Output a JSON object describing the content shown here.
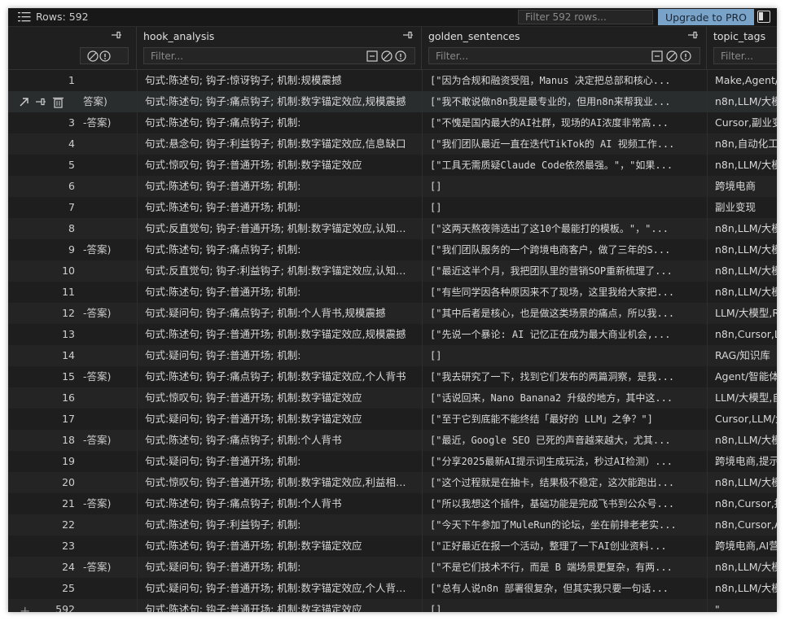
{
  "topbar": {
    "rows_label": "Rows: 592",
    "filter_placeholder": "Filter 592 rows...",
    "upgrade_label": "Upgrade to PRO"
  },
  "columns": [
    {
      "name": "hook_analysis",
      "filter_placeholder": "Filter..."
    },
    {
      "name": "golden_sentences",
      "filter_placeholder": "Filter..."
    },
    {
      "name": "topic_tags",
      "filter_placeholder": "Filter..."
    }
  ],
  "rows": [
    {
      "num": "1",
      "prev": "",
      "hook": "句式:陈述句; 钩子:惊讶钩子; 机制:规模震撼",
      "gold": "[\"因为合规和融资受阻，Manus 决定把总部和核心...",
      "topic": "Make,Agent/智"
    },
    {
      "num": "",
      "prev": "答案)",
      "hook": "句式:陈述句; 钩子:痛点钩子; 机制:数字锚定效应,规模震撼",
      "gold": "[\"我不敢说做n8n我是最专业的，但用n8n来帮我业...",
      "topic": "n8n,LLM/大模型"
    },
    {
      "num": "3",
      "prev": "-答案)",
      "hook": "句式:陈述句; 钩子:痛点钩子; 机制:",
      "gold": "[\"不愧是国内最大的AI社群，现场的AI浓度非常高...",
      "topic": "Cursor,副业变现"
    },
    {
      "num": "4",
      "prev": "",
      "hook": "句式:悬念句; 钩子:利益钩子; 机制:数字锚定效应,信息缺口",
      "gold": "[\"我们团队最近一直在迭代TikTok的 AI 视频工作...",
      "topic": "n8n,自动化工作"
    },
    {
      "num": "5",
      "prev": "",
      "hook": "句式:惊叹句; 钩子:普通开场; 机制:数字锚定效应",
      "gold": "[\"工具无需质疑Claude Code依然最强。\"，\"如果...",
      "topic": "n8n,LLM/大模型"
    },
    {
      "num": "6",
      "prev": "",
      "hook": "句式:陈述句; 钩子:普通开场; 机制:",
      "gold": "[]",
      "topic": "跨境电商"
    },
    {
      "num": "7",
      "prev": "",
      "hook": "句式:陈述句; 钩子:普通开场; 机制:",
      "gold": "[]",
      "topic": "副业变现"
    },
    {
      "num": "8",
      "prev": "",
      "hook": "句式:反直觉句; 钩子:普通开场; 机制:数字锚定效应,认知冲...",
      "gold": "[\"这两天熬夜筛选出了这10个最能打的模板。\"，\"...",
      "topic": "n8n,LLM/大模型"
    },
    {
      "num": "9",
      "prev": "-答案)",
      "hook": "句式:陈述句; 钩子:痛点钩子; 机制:",
      "gold": "[\"我们团队服务的一个跨境电商客户，做了三年的S...",
      "topic": "n8n,LLM/大模型"
    },
    {
      "num": "10",
      "prev": "",
      "hook": "句式:反直觉句; 钩子:利益钩子; 机制:数字锚定效应,认知冲...",
      "gold": "[\"最近这半个月，我把团队里的营销SOP重新梳理了...",
      "topic": "n8n,LLM/大模型"
    },
    {
      "num": "11",
      "prev": "",
      "hook": "句式:陈述句; 钩子:普通开场; 机制:",
      "gold": "[\"有些同学因各种原因来不了现场，这里我给大家把...",
      "topic": "n8n,LLM/大模型"
    },
    {
      "num": "12",
      "prev": "-答案)",
      "hook": "句式:疑问句; 钩子:痛点钩子; 机制:个人背书,规模震撼",
      "gold": "[\"其中后者是核心，也是做这类场景的痛点，所以我...",
      "topic": "LLM/大模型,RA"
    },
    {
      "num": "13",
      "prev": "",
      "hook": "句式:陈述句; 钩子:普通开场; 机制:数字锚定效应,规模震撼",
      "gold": "[\"先说一个暴论: AI 记忆正在成为最大商业机会,...",
      "topic": "n8n,Cursor,LLM"
    },
    {
      "num": "14",
      "prev": "",
      "hook": "句式:疑问句; 钩子:普通开场; 机制:",
      "gold": "[]",
      "topic": "RAG/知识库"
    },
    {
      "num": "15",
      "prev": "-答案)",
      "hook": "句式:陈述句; 钩子:痛点钩子; 机制:数字锚定效应,个人背书",
      "gold": "[\"我去研究了一下，找到它们发布的两篇洞察，是我...",
      "topic": "Agent/智能体,"
    },
    {
      "num": "16",
      "prev": "",
      "hook": "句式:惊叹句; 钩子:普通开场; 机制:数字锚定效应",
      "gold": "[\"话说回来，Nano Banana2 升级的地方，其中这...",
      "topic": "LLM/大模型,自"
    },
    {
      "num": "17",
      "prev": "",
      "hook": "句式:疑问句; 钩子:普通开场; 机制:数字锚定效应",
      "gold": "[\"至于它到底能不能终结「最好的 LLM」之争？\"]",
      "topic": "Cursor,LLM/大"
    },
    {
      "num": "18",
      "prev": "-答案)",
      "hook": "句式:陈述句; 钩子:痛点钩子; 机制:个人背书",
      "gold": "[\"最近，Google SEO 已死的声音越来越大，尤其...",
      "topic": "n8n,LLM/大模型"
    },
    {
      "num": "19",
      "prev": "",
      "hook": "句式:疑问句; 钩子:普通开场; 机制:",
      "gold": "[\"分享2025最新AI提示词生成玩法，秒过AI检测）...",
      "topic": "跨境电商,提示词"
    },
    {
      "num": "20",
      "prev": "",
      "hook": "句式:惊叹句; 钩子:普通开场; 机制:数字锚定效应,利益相关...",
      "gold": "[\"这个过程就是在抽卡，结果极不稳定，这次能跑出...",
      "topic": "n8n,LLM/大模型"
    },
    {
      "num": "21",
      "prev": "-答案)",
      "hook": "句式:陈述句; 钩子:痛点钩子; 机制:个人背书",
      "gold": "[\"所以我想这个插件，基础功能是完成飞书到公众号...",
      "topic": "n8n,Cursor,提效"
    },
    {
      "num": "22",
      "prev": "",
      "hook": "句式:陈述句; 钩子:利益钩子; 机制:",
      "gold": "[\"今天下午参加了MuleRun的论坛，坐在前排老老实...",
      "topic": "n8n,Cursor,Age"
    },
    {
      "num": "23",
      "prev": "",
      "hook": "句式:陈述句; 钩子:普通开场; 机制:数字锚定效应",
      "gold": "[\"正好最近在报一个活动，整理了一下AI创业资料...",
      "topic": "跨境电商,AI营销"
    },
    {
      "num": "24",
      "prev": "-答案)",
      "hook": "句式:疑问句; 钩子:普通开场; 机制:",
      "gold": "[\"不是它们技术不行，而是 B 端场景更复杂，有两...",
      "topic": "n8n,LLM/大模型"
    },
    {
      "num": "25",
      "prev": "",
      "hook": "句式:疑问句; 钩子:普通开场; 机制:数字锚定效应,个人背书...",
      "gold": "[\"总有人说n8n 部署很复杂，但其实我只要一句话...",
      "topic": "n8n,LLM/大模型"
    },
    {
      "num": "592",
      "prev": "",
      "hook": "句式:陈述句; 钩子:普通开场; 机制:数字锚定效应",
      "gold": "[]",
      "topic": "\""
    }
  ],
  "colors": {
    "background": "#1e1e1e",
    "accent": "#7aa3c9"
  },
  "icons": [
    "rows-icon",
    "unpin-icon",
    "clear-icon",
    "block-icon",
    "info-icon",
    "expand-icon",
    "pin-icon",
    "trash-icon",
    "panel-toggle-icon",
    "add-icon"
  ]
}
